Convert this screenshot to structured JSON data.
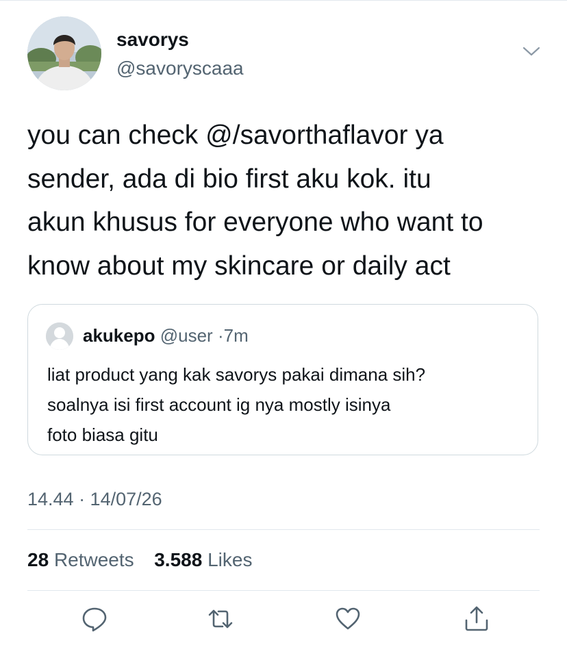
{
  "tweet": {
    "author": {
      "display_name": "savorys",
      "handle": "@savoryscaaa",
      "avatar_icon": "profile-photo"
    },
    "menu_icon": "chevron-down-icon",
    "text_lines": [
      "you can check @/savorthaflavor ya",
      "sender, ada di bio first aku kok. itu",
      "akun khusus for everyone who want to",
      "know about my skincare or daily act"
    ],
    "quote": {
      "name": "akukepo",
      "handle": "@user",
      "separator": "·",
      "time": "7m",
      "avatar_icon": "default-avatar-icon",
      "text_lines": [
        "liat product yang kak savorys pakai dimana sih?",
        "soalnya isi first account ig nya mostly isinya",
        "foto biasa gitu"
      ]
    },
    "timestamp": "14.44 · 14/07/26",
    "stats": {
      "retweets_count": "28",
      "retweets_label": "Retweets",
      "likes_count": "3.588",
      "likes_label": "Likes"
    },
    "actions": {
      "reply_icon": "reply-icon",
      "retweet_icon": "retweet-icon",
      "like_icon": "heart-icon",
      "share_icon": "share-icon"
    }
  },
  "colors": {
    "text_primary": "#0f1419",
    "text_secondary": "#536471",
    "divider": "#e1e8ed",
    "card_border": "#cfd9de",
    "icon": "#536471"
  }
}
